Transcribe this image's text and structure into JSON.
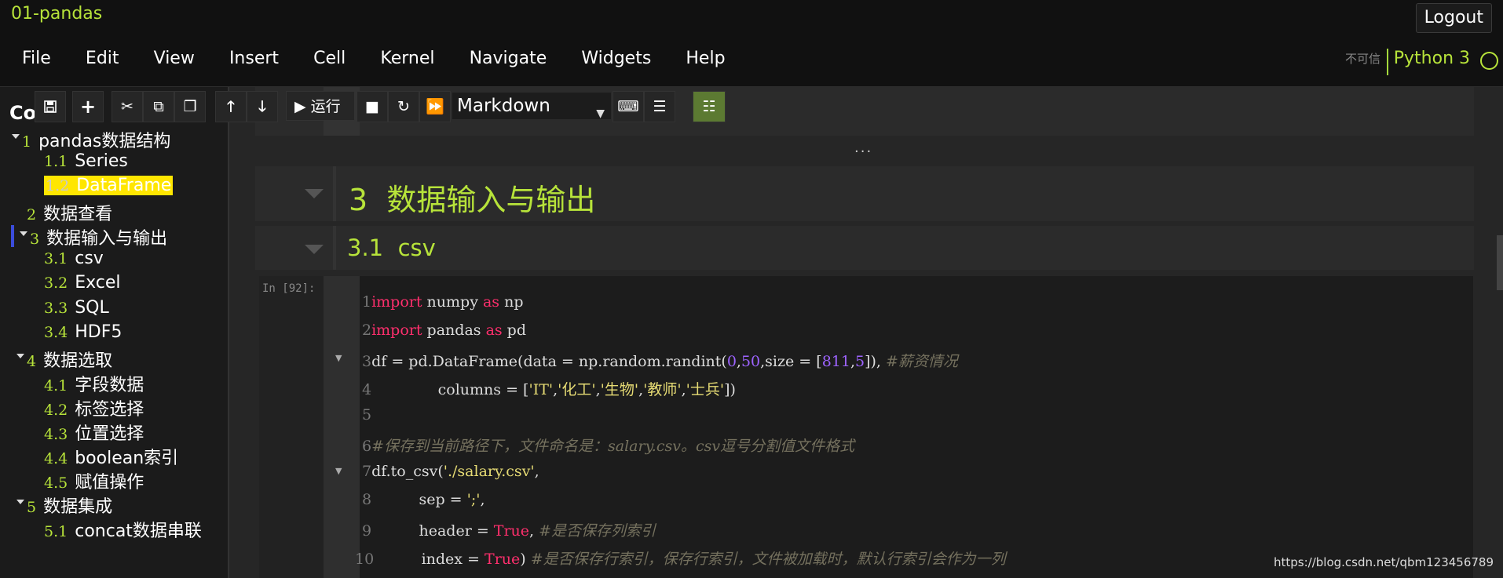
{
  "header": {
    "notebook_name": "01-pandas",
    "logout_label": "Logout",
    "trust_label": "不可信",
    "kernel_name": "Python 3"
  },
  "menu": [
    "File",
    "Edit",
    "View",
    "Insert",
    "Cell",
    "Kernel",
    "Navigate",
    "Widgets",
    "Help"
  ],
  "toolbar": {
    "run_label": "运行",
    "cell_type": "Markdown"
  },
  "toc": {
    "title": "Co",
    "items": [
      {
        "num": "1",
        "label": "pandas数据结构"
      },
      {
        "num": "1.1",
        "label": "Series"
      },
      {
        "num": "1.2",
        "label": "DataFrame"
      },
      {
        "num": "2",
        "label": "数据查看"
      },
      {
        "num": "3",
        "label": "数据输入与输出"
      },
      {
        "num": "3.1",
        "label": "csv"
      },
      {
        "num": "3.2",
        "label": "Excel"
      },
      {
        "num": "3.3",
        "label": "SQL"
      },
      {
        "num": "3.4",
        "label": "HDF5"
      },
      {
        "num": "4",
        "label": "数据选取"
      },
      {
        "num": "4.1",
        "label": "字段数据"
      },
      {
        "num": "4.2",
        "label": "标签选择"
      },
      {
        "num": "4.3",
        "label": "位置选择"
      },
      {
        "num": "4.4",
        "label": "boolean索引"
      },
      {
        "num": "4.5",
        "label": "赋值操作"
      },
      {
        "num": "5",
        "label": "数据集成"
      },
      {
        "num": "5.1",
        "label": "concat数据串联"
      }
    ]
  },
  "cells": {
    "ellipsis": "...",
    "heading3_num": "3",
    "heading3": "数据输入与输出",
    "heading31_num": "3.1",
    "heading31": "csv",
    "prompt": "In  [92]:"
  },
  "code": {
    "l1": {
      "n": "1",
      "kw1": "import",
      "a": " numpy ",
      "kw2": "as",
      "b": " np"
    },
    "l2": {
      "n": "2",
      "kw1": "import",
      "a": " pandas ",
      "kw2": "as",
      "b": " pd"
    },
    "l3": {
      "n": "3",
      "a": "df = pd.DataFrame(data = np.random.randint(",
      "n1": "0",
      "c1": ",",
      "n2": "50",
      "b": ",size = [",
      "n3": "811",
      "c2": ",",
      "n4": "5",
      "c": "]), ",
      "cmt": "#薪资情况"
    },
    "l4": {
      "n": "4",
      "a": "              columns = [",
      "s1": "'IT'",
      "c1": ",",
      "s2": "'化工'",
      "c2": ",",
      "s3": "'生物'",
      "c3": ",",
      "s4": "'教师'",
      "c4": ",",
      "s5": "'士兵'",
      "b": "])"
    },
    "l5": {
      "n": "5"
    },
    "l6": {
      "n": "6",
      "cmt": "#保存到当前路径下，文件命名是：salary.csv。csv逗号分割值文件格式"
    },
    "l7": {
      "n": "7",
      "a": "df.to_csv(",
      "s": "'./salary.csv'",
      "b": ","
    },
    "l8": {
      "n": "8",
      "a": "          sep = ",
      "s": "';'",
      "b": ","
    },
    "l9": {
      "n": "9",
      "a": "          header = ",
      "kw": "True",
      "b": ", ",
      "cmt": "#是否保存列索引"
    },
    "l10": {
      "n": "10",
      "a": "          index = ",
      "kw": "True",
      "b": ") ",
      "cmt": "#是否保存行索引，保存行索引，文件被加载时，默认行索引会作为一列"
    }
  },
  "watermark": "https://blog.csdn.net/qbm123456789"
}
